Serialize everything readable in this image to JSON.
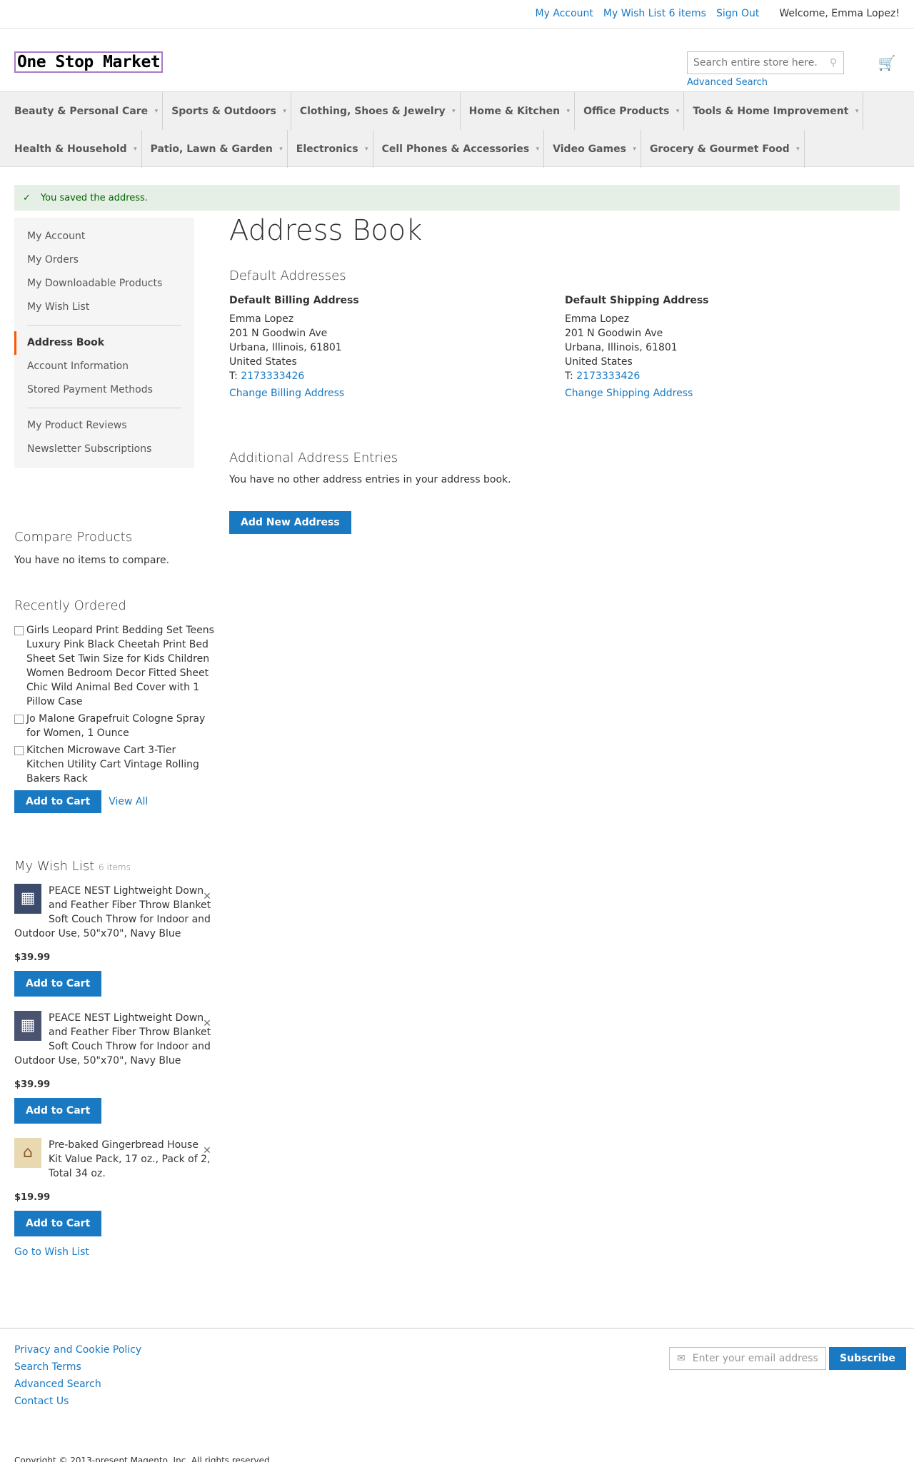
{
  "topbar": {
    "my_account": "My Account",
    "wish_list": "My Wish List 6 items",
    "sign_out": "Sign Out",
    "welcome": "Welcome, Emma Lopez!"
  },
  "header": {
    "logo": "One Stop Market",
    "search_placeholder": "Search entire store here...",
    "advanced_search": "Advanced Search"
  },
  "nav": {
    "row1": [
      "Beauty & Personal Care",
      "Sports & Outdoors",
      "Clothing, Shoes & Jewelry",
      "Home & Kitchen",
      "Office Products",
      "Tools & Home Improvement"
    ],
    "row2": [
      "Health & Household",
      "Patio, Lawn & Garden",
      "Electronics",
      "Cell Phones & Accessories",
      "Video Games",
      "Grocery & Gourmet Food"
    ]
  },
  "message": "You saved the address.",
  "sidebar": {
    "group1": [
      "My Account",
      "My Orders",
      "My Downloadable Products",
      "My Wish List"
    ],
    "current": "Address Book",
    "group2": [
      "Account Information",
      "Stored Payment Methods"
    ],
    "group3": [
      "My Product Reviews",
      "Newsletter Subscriptions"
    ]
  },
  "main": {
    "title": "Address Book",
    "default_addresses": "Default Addresses",
    "billing": {
      "title": "Default Billing Address",
      "name": "Emma Lopez",
      "street": "201 N Goodwin Ave",
      "city": "Urbana, Illinois, 61801",
      "country": "United States",
      "phone_prefix": "T: ",
      "phone": "2173333426",
      "change": "Change Billing Address"
    },
    "shipping": {
      "title": "Default Shipping Address",
      "name": "Emma Lopez",
      "street": "201 N Goodwin Ave",
      "city": "Urbana, Illinois, 61801",
      "country": "United States",
      "phone_prefix": "T: ",
      "phone": "2173333426",
      "change": "Change Shipping Address"
    },
    "additional_title": "Additional Address Entries",
    "no_entries": "You have no other address entries in your address book.",
    "add_new": "Add New Address"
  },
  "compare": {
    "title": "Compare Products",
    "empty": "You have no items to compare."
  },
  "recently_ordered": {
    "title": "Recently Ordered",
    "items": [
      "Girls Leopard Print Bedding Set Teens Luxury Pink Black Cheetah Print Bed Sheet Set Twin Size for Kids Children Women Bedroom Decor Fitted Sheet Chic Wild Animal Bed Cover with 1 Pillow Case",
      "Jo Malone Grapefruit Cologne Spray for Women, 1 Ounce",
      "Kitchen Microwave Cart 3-Tier Kitchen Utility Cart Vintage Rolling Bakers Rack"
    ],
    "add_to_cart": "Add to Cart",
    "view_all": "View All"
  },
  "wishlist": {
    "title": "My Wish List",
    "count": "6 items",
    "items": [
      {
        "name": "PEACE NEST Lightweight Down and Feather Fiber Throw Blanket Soft Couch Throw for Indoor and Outdoor Use, 50\"x70\", Navy Blue",
        "price": "$39.99"
      },
      {
        "name": "PEACE NEST Lightweight Down and Feather Fiber Throw Blanket Soft Couch Throw for Indoor and Outdoor Use, 50\"x70\", Navy Blue",
        "price": "$39.99"
      },
      {
        "name": "Pre-baked Gingerbread House Kit Value Pack, 17 oz., Pack of 2, Total 34 oz.",
        "price": "$19.99"
      }
    ],
    "add_to_cart": "Add to Cart",
    "go_to": "Go to Wish List"
  },
  "footer": {
    "links": [
      "Privacy and Cookie Policy",
      "Search Terms",
      "Advanced Search",
      "Contact Us"
    ],
    "newsletter_placeholder": "Enter your email address",
    "subscribe": "Subscribe",
    "copyright": "Copyright © 2013-present Magento, Inc. All rights reserved."
  }
}
